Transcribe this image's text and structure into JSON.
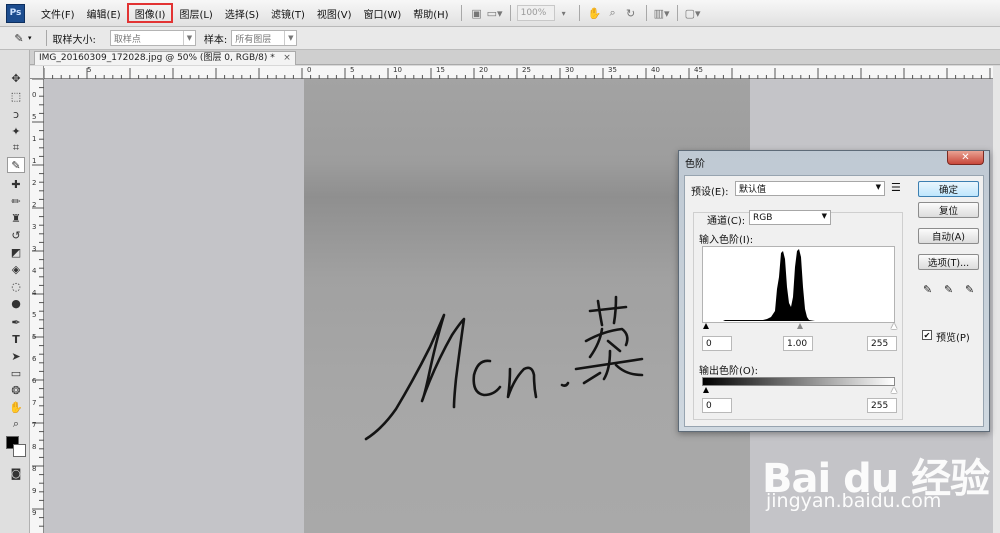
{
  "menubar": {
    "logo": "Ps",
    "items": [
      "文件(F)",
      "编辑(E)",
      "图像(I)",
      "图层(L)",
      "选择(S)",
      "滤镜(T)",
      "视图(V)",
      "窗口(W)",
      "帮助(H)"
    ],
    "zoom": "100%"
  },
  "options": {
    "sample_size_label": "取样大小:",
    "sample_size_value": "取样点",
    "sample_label": "样本:",
    "sample_value": "所有图层"
  },
  "document": {
    "tab_title": "IMG_20160309_172028.jpg @ 50% (图层 0, RGB/8) *",
    "signature_text": "Mcn.蔡"
  },
  "rulers": {
    "h_labels": [
      "5",
      "0",
      "5",
      "10",
      "15",
      "20",
      "25",
      "30",
      "35",
      "40",
      "45"
    ],
    "v_labels": [
      "0",
      "5",
      "1",
      "1",
      "2",
      "2",
      "3",
      "3",
      "4",
      "4",
      "5",
      "5",
      "6",
      "6",
      "7",
      "7",
      "8",
      "8",
      "9",
      "9"
    ]
  },
  "levels_dialog": {
    "title": "色阶",
    "preset_label": "预设(E):",
    "preset_value": "默认值",
    "channel_label": "通道(C):",
    "channel_value": "RGB",
    "input_levels_label": "输入色阶(I):",
    "input_black": "0",
    "input_gamma": "1.00",
    "input_white": "255",
    "output_levels_label": "输出色阶(O):",
    "output_black": "0",
    "output_white": "255",
    "buttons": {
      "ok": "确定",
      "reset": "复位",
      "auto": "自动(A)",
      "options": "选项(T)..."
    },
    "preview_label": "预览(P)",
    "preview_checked": true
  },
  "watermark": {
    "brand": "Bai du 经验",
    "url": "jingyan.baidu.com"
  }
}
